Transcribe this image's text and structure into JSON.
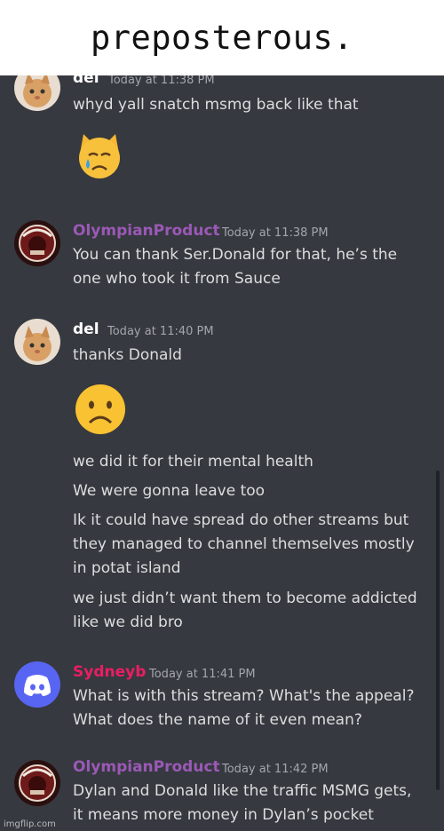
{
  "caption": "preposterous.",
  "colors": {
    "background": "#36393f",
    "olympian": "#9b59b6",
    "sydneyb": "#e91e63",
    "del": "#ffffff",
    "discord_blurple": "#5865f2"
  },
  "messages": {
    "m1": {
      "author": "del",
      "time": "Today at 11:38 PM",
      "text": "whyd yall snatch msmg back like that",
      "emoji": "crying-cat-face"
    },
    "m2": {
      "author": "OlympianProduct",
      "time": "Today at 11:38 PM",
      "lines": [
        "You can thank Ser.Donald for that, he’s the",
        "one who took it from Sauce"
      ]
    },
    "m3": {
      "author": "del",
      "time": "Today at 11:40 PM",
      "text": "thanks Donald",
      "emoji": "frowning-face",
      "followups": {
        "f1": "we did it for their mental health",
        "f2": "We were gonna leave too",
        "f3": [
          "Ik it could have spread do other streams but",
          "they managed to channel themselves mostly",
          "in potat island"
        ],
        "f4": [
          "we just didn’t want them to become addicted",
          "like we did bro"
        ]
      }
    },
    "m4": {
      "author": "Sydneyb",
      "time": "Today at 11:41 PM",
      "lines": [
        "What is with this stream? What's the appeal?",
        "What does the name of it even mean?"
      ]
    },
    "m5": {
      "author": "OlympianProduct",
      "time": "Today at 11:42 PM",
      "lines": [
        "Dylan and Donald like the traffic MSMG gets,",
        "it means more money in Dylan’s pocket"
      ]
    }
  },
  "watermark": "imgflip.com"
}
